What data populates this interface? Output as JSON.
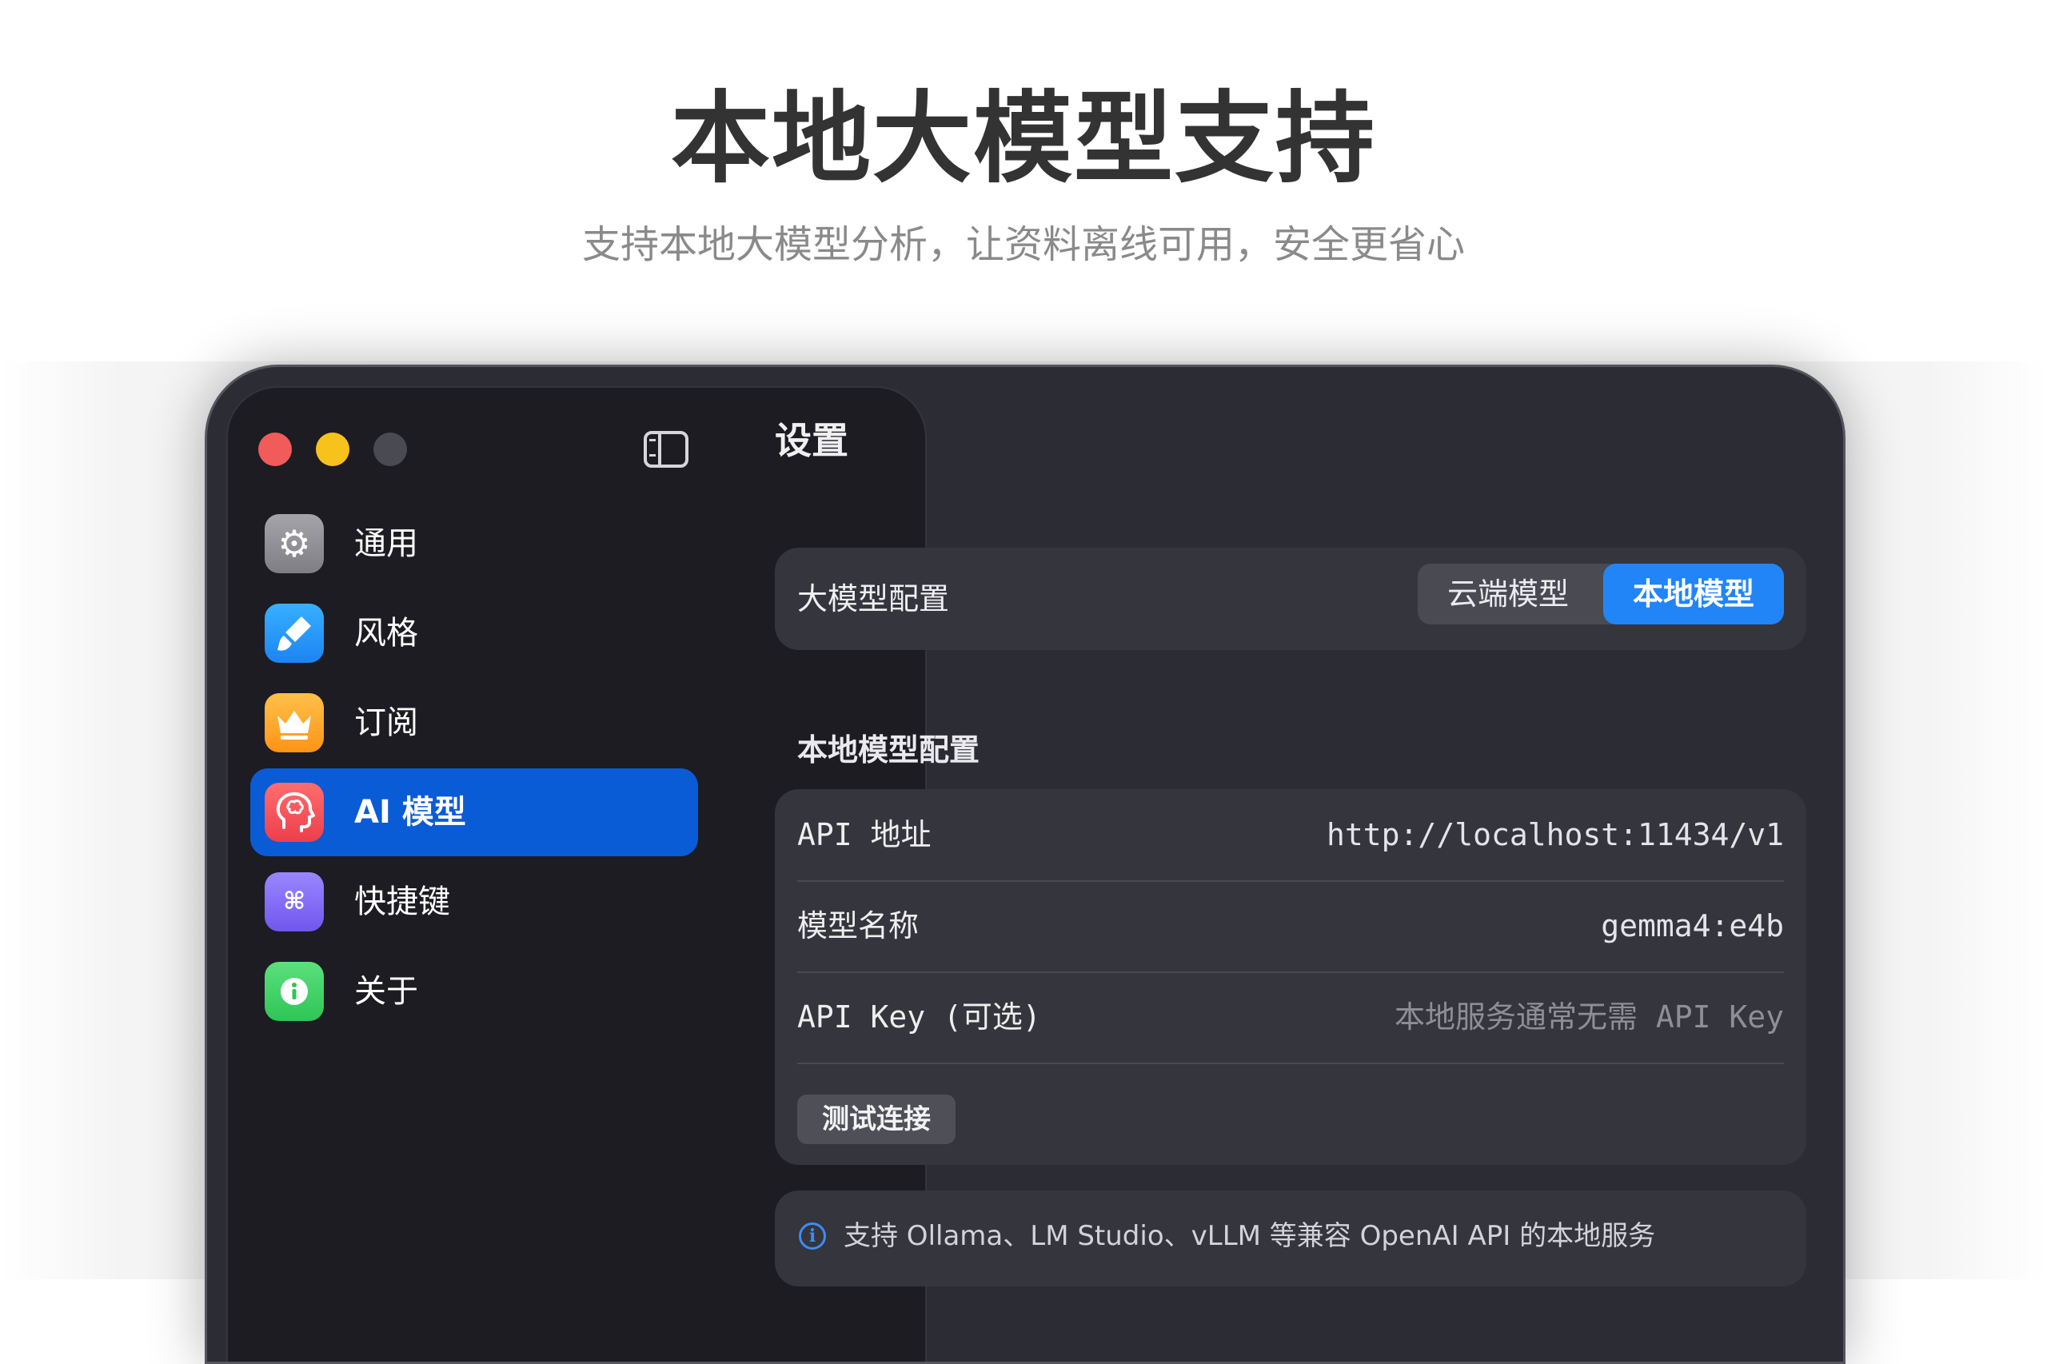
{
  "hero": {
    "title": "本地大模型支持",
    "subtitle": "支持本地大模型分析，让资料离线可用，安全更省心"
  },
  "sidebar": {
    "items": [
      {
        "label": "通用",
        "icon": "gear-icon",
        "color": "#8e8e94"
      },
      {
        "label": "风格",
        "icon": "brush-icon",
        "color": "#1c84f4"
      },
      {
        "label": "订阅",
        "icon": "crown-icon",
        "color": "#ff9f1a"
      },
      {
        "label": "AI 模型",
        "icon": "brain-icon",
        "color": "#f04b57",
        "active": true
      },
      {
        "label": "快捷键",
        "icon": "command-icon",
        "color": "#7d65f5"
      },
      {
        "label": "关于",
        "icon": "info-icon",
        "color": "#36c85d"
      }
    ]
  },
  "main": {
    "title": "设置",
    "llm_config": {
      "label": "大模型配置",
      "options": [
        "云端模型",
        "本地模型"
      ],
      "selected": "本地模型"
    },
    "local_section": {
      "heading": "本地模型配置",
      "rows": [
        {
          "label": "API 地址",
          "value": "http://localhost:11434/v1"
        },
        {
          "label": "模型名称",
          "value": "gemma4:e4b"
        },
        {
          "label": "API Key (可选)",
          "placeholder": "本地服务通常无需 API Key"
        }
      ],
      "test_button": "测试连接"
    },
    "info": {
      "text": "支持 Ollama、LM Studio、vLLM 等兼容 OpenAI API 的本地服务"
    }
  },
  "colors": {
    "accent": "#2185f7",
    "active_nav": "#0a5bd6",
    "window_bg": "#2c2c34",
    "sidebar_bg": "#1c1c22"
  }
}
